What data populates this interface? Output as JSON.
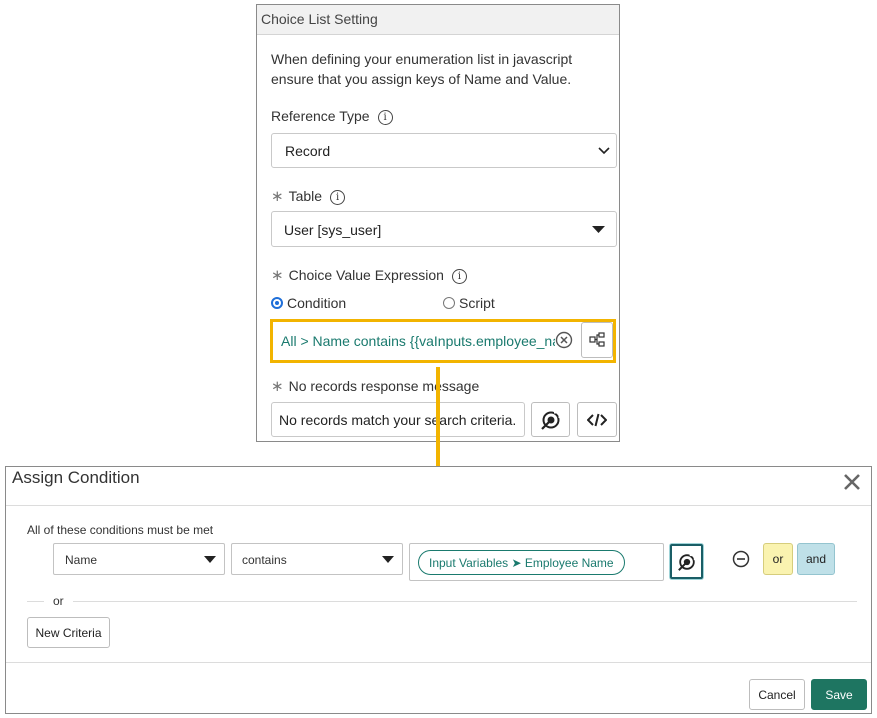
{
  "choice_list": {
    "title": "Choice List Setting",
    "description": "When defining your enumeration list in javascript ensure that you assign keys of Name and Value.",
    "reference_type": {
      "label": "Reference Type",
      "value": "Record"
    },
    "table": {
      "label": "Table",
      "value": "User [sys_user]"
    },
    "choice_value_expression": {
      "label": "Choice Value Expression",
      "options": [
        "Condition",
        "Script"
      ],
      "selected": "Condition",
      "value": "All > Name contains {{vaInputs.employee_name"
    },
    "no_records": {
      "label": "No records response message",
      "value": "No records match your search criteria."
    }
  },
  "assign_condition": {
    "title": "Assign Condition",
    "heading": "All of these conditions must be met",
    "field": "Name",
    "operator": "contains",
    "value_pill": "Input Variables ➤ Employee Name",
    "or_button": "or",
    "and_button": "and",
    "or_label": "or",
    "new_criteria": "New Criteria",
    "cancel": "Cancel",
    "save": "Save"
  },
  "colors": {
    "highlight": "#f2b400",
    "teal": "#1a7a6e",
    "or_bg": "#faf3b0",
    "and_bg": "#bfe0e8",
    "save_bg": "#1e7561"
  }
}
